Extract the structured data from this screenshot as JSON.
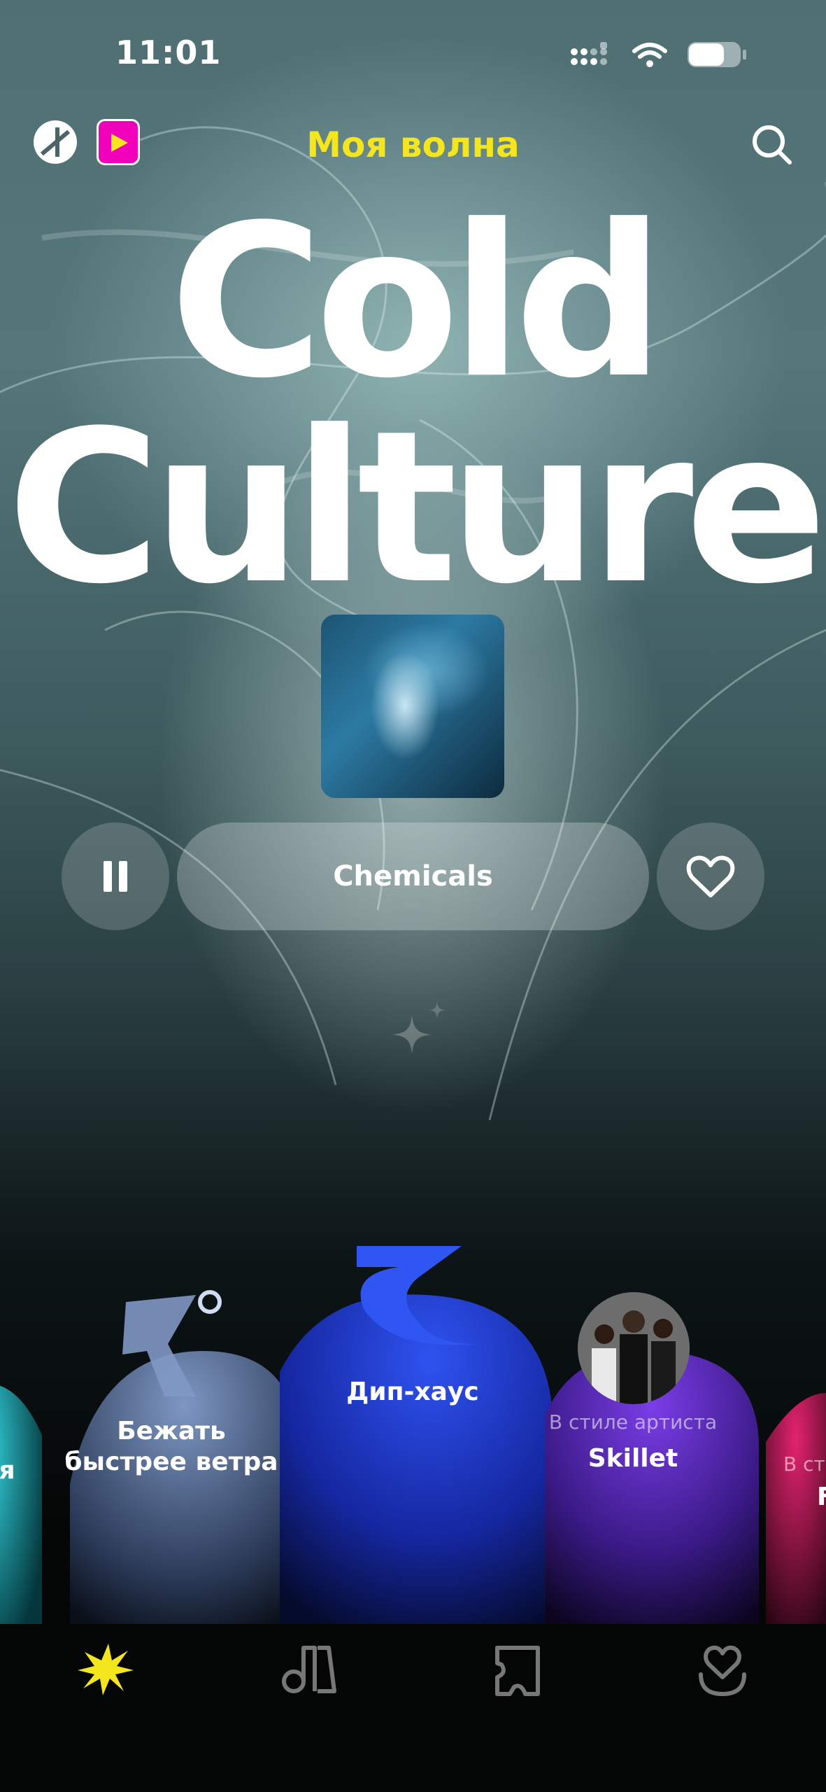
{
  "status_bar": {
    "time": "11:01"
  },
  "header": {
    "title": "Моя волна"
  },
  "hero": {
    "line1": "Cold",
    "line2": "Culture"
  },
  "player": {
    "track": "Chemicals"
  },
  "waves": [
    {
      "label": "я",
      "sub": ""
    },
    {
      "label": "Бежать быстрее ветра",
      "sub": ""
    },
    {
      "label": "Дип-хаус",
      "sub": ""
    },
    {
      "label": "Skillet",
      "sub": "В стиле артиста"
    },
    {
      "label": "F",
      "sub": "В сти"
    }
  ],
  "colors": {
    "accent": "#f5e51c",
    "deep_house": "#1d3fd8",
    "skillet": "#6a3bd8",
    "run": "#5a78a8",
    "teal": "#13a6b7"
  },
  "nav": {
    "icons": [
      "wave-icon",
      "music-icon",
      "collection-icon",
      "heart-icon"
    ]
  }
}
